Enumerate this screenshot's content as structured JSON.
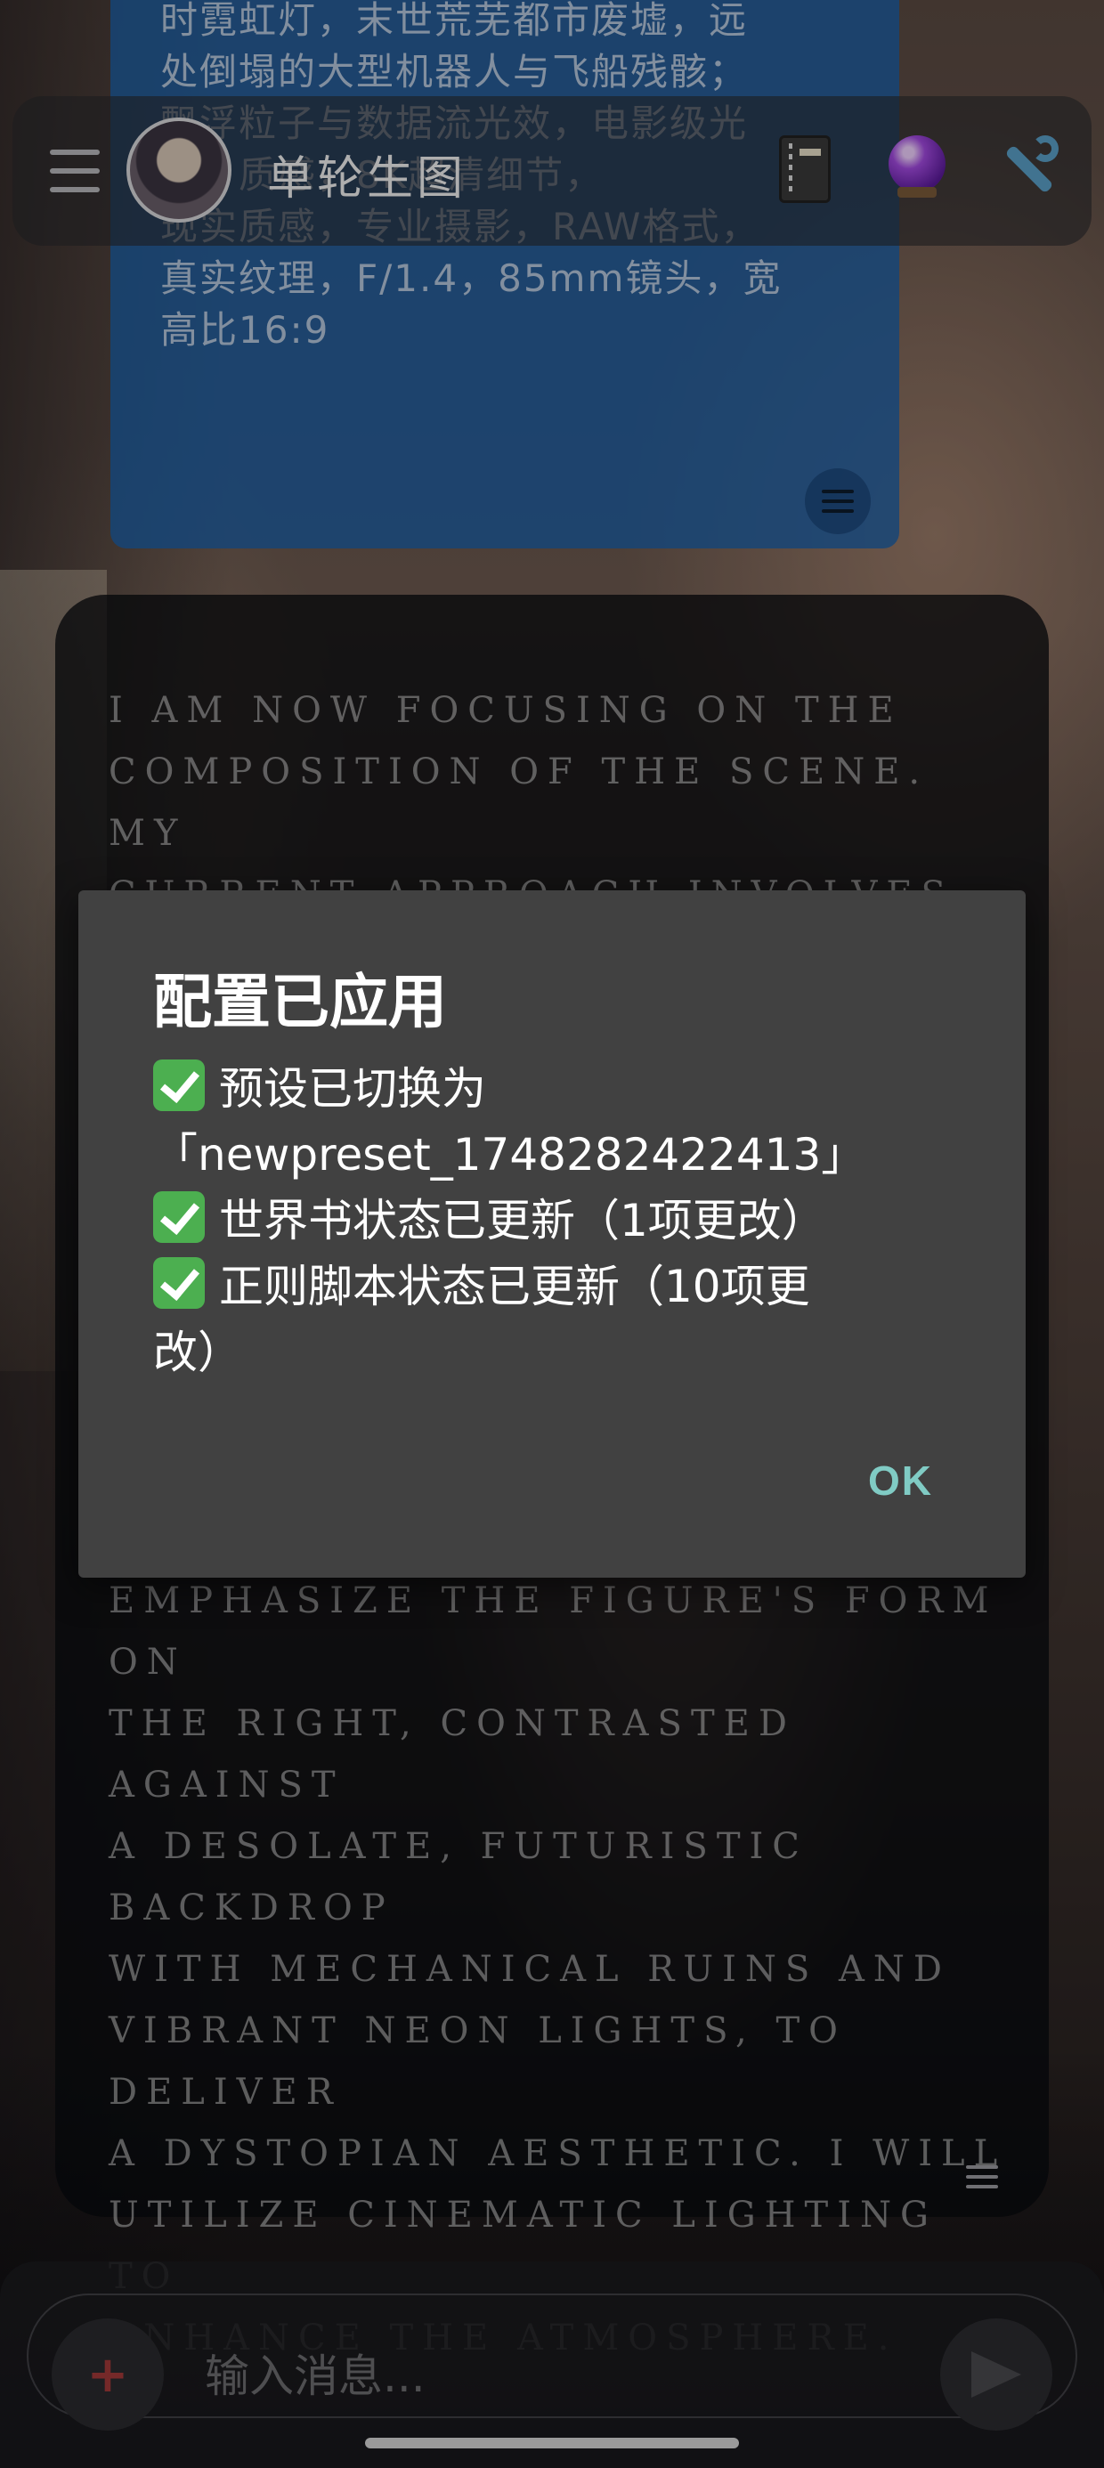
{
  "header": {
    "title": "单轮生图",
    "icons": [
      "menu-icon",
      "avatar",
      "notebook-icon",
      "crystal-ball-icon",
      "wrench-icon"
    ]
  },
  "user_message": {
    "text": "时霓虹灯，末世荒芜都市废墟，远\n处倒塌的大型机器人与飞船残骸；\n飘浮粒子与数据流光效，电影级光\n影，质感，8K超清细节，\n现实质感，专业摄影，RAW格式，\n真实纹理，F/1.4，85mm镜头，宽\n高比16:9"
  },
  "assistant_message": {
    "text_top": "I am now focusing on the\ncomposition of the scene. My\ncurrent approach involves\nplacing the figure on the",
    "text_bottom": "emphasize the figure's form on\nthe right, contrasted against\na desolate, futuristic backdrop\nwith mechanical ruins and\nvibrant neon lights, to deliver\na dystopian aesthetic. I will\nutilize cinematic lighting to\nenhance the atmosphere."
  },
  "dialog": {
    "title": "配置已应用",
    "lines": [
      "预设已切换为\n「newpreset_1748282422413」",
      "世界书状态已更新（1项更改）",
      "正则脚本状态已更新（10项更\n改）"
    ],
    "ok_label": "OK"
  },
  "input": {
    "placeholder": "输入消息...",
    "add_label": "+"
  },
  "colors": {
    "user_bubble": "#1c60a8",
    "dialog_bg": "#414141",
    "ok_accent": "#80cbc4",
    "check_green": "#4caf50"
  }
}
